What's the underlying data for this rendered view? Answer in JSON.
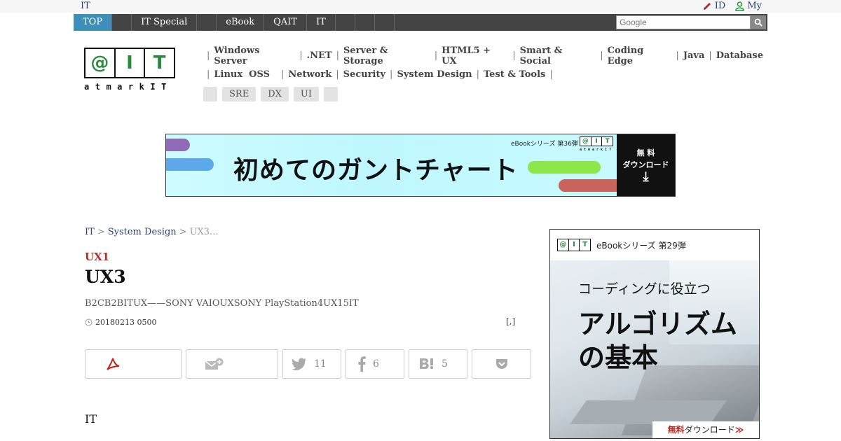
{
  "topbar": {
    "brand": "IT",
    "links": [
      {
        "label": "ID",
        "icon": "pencil-icon"
      },
      {
        "label": "My",
        "icon": "user-icon"
      }
    ]
  },
  "gnav": {
    "items": [
      "TOP",
      "",
      "IT Special",
      "",
      "eBook",
      "QAIT",
      "IT",
      "",
      "",
      ""
    ],
    "active_index": 0,
    "search_placeholder": "Google"
  },
  "logo": {
    "cells": [
      "@",
      "I",
      "T"
    ],
    "sub": "atmarkIT"
  },
  "categories": {
    "line1": [
      "Windows Server",
      ".NET",
      "Server & Storage",
      "HTML5 + UX",
      "Smart & Social",
      "Coding Edge",
      "Java",
      "Database"
    ],
    "line2": [
      "Linux  OSS",
      "Network",
      "Security",
      "System Design",
      "Test & Tools"
    ],
    "tags": [
      "",
      "SRE",
      "DX",
      "UI",
      ""
    ]
  },
  "banner": {
    "headline": "初めてのガントチャート",
    "series": "eBookシリーズ 第36弾",
    "download_line1": "無 料",
    "download_line2": "ダウンロード",
    "download_arrow": "⤓"
  },
  "breadcrumb": {
    "items": [
      "IT",
      "System Design"
    ],
    "current": "UX3...",
    "separator": ">"
  },
  "article": {
    "kicker": "UX1",
    "title": "UX3",
    "lead": "B2CB2BITUX——SONY VAIOUXSONY PlayStation4UX15IT",
    "date": "20180213 0500",
    "author": "[,]",
    "body_first": "IT"
  },
  "share": {
    "twitter_count": "11",
    "facebook_count": "6",
    "hatena_count": "5"
  },
  "side_ad": {
    "series": "eBookシリーズ 第29弾",
    "headline1": "コーディングに役立つ",
    "headline2": "アルゴリズム",
    "headline3": "の基本",
    "footer_red": "無料",
    "footer_rest": "ダウンロード",
    "footer_arrow": "≫"
  }
}
